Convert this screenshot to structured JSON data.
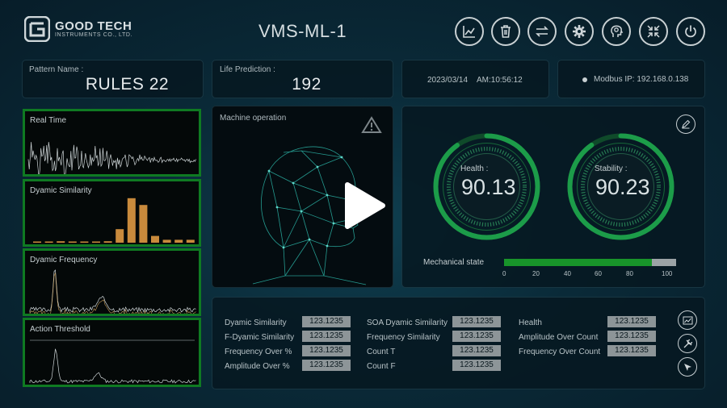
{
  "header": {
    "company_name": "GOOD TECH",
    "company_sub": "INSTRUMENTS CO., LTD.",
    "app_title": "VMS-ML-1"
  },
  "toolbar": {
    "buttons": [
      {
        "name": "trend-icon"
      },
      {
        "name": "trash-icon"
      },
      {
        "name": "swap-icon"
      },
      {
        "name": "gear-icon"
      },
      {
        "name": "brain-head-icon"
      },
      {
        "name": "collapse-icon"
      },
      {
        "name": "power-icon"
      }
    ]
  },
  "info": {
    "pattern_label": "Pattern Name :",
    "pattern_value": "RULES 22",
    "life_label": "Life Prediction :",
    "life_value": "192",
    "date": "2023/03/14",
    "time": "AM:10:56:12",
    "modbus": "Modbus IP: 192.168.0.138"
  },
  "charts": {
    "real_time": "Real Time",
    "dyn_similarity": "Dyamic Similarity",
    "dyn_frequency": "Dyamic Frequency",
    "action_threshold": "Action Threshold",
    "dyn_similarity_bars": [
      0.02,
      0.02,
      0.03,
      0.02,
      0.02,
      0.02,
      0.03,
      0.28,
      0.92,
      0.78,
      0.14,
      0.06,
      0.06,
      0.06
    ]
  },
  "machine": {
    "title": "Machine operation"
  },
  "status": {
    "health_label": "Health :",
    "health_value": "90.13",
    "stability_label": "Stability :",
    "stability_value": "90.23",
    "mech_label": "Mechanical state",
    "mech_level": 0.86,
    "scale": [
      "0",
      "20",
      "40",
      "60",
      "80",
      "100"
    ],
    "colors": {
      "gauge": "#1c9c49",
      "bar": "#18942a",
      "bar_track": "#9ba3a6"
    }
  },
  "readings": {
    "col1": [
      {
        "label": "Dyamic Similarity",
        "value": "123.1235"
      },
      {
        "label": "F-Dyamic Similarity",
        "value": "123.1235"
      },
      {
        "label": "Frequency Over %",
        "value": "123.1235"
      },
      {
        "label": "Amplitude Over %",
        "value": "123.1235"
      }
    ],
    "col2": [
      {
        "label": "SOA Dyamic Similarity",
        "value": "123.1235"
      },
      {
        "label": "Frequency Similarity",
        "value": "123.1235"
      },
      {
        "label": "Count T",
        "value": "123.1235"
      },
      {
        "label": "Count F",
        "value": "123.1235"
      }
    ],
    "col3": [
      {
        "label": "Health",
        "value": "123.1235"
      },
      {
        "label": "Amplitude Over Count",
        "value": "123.1235"
      },
      {
        "label": "Frequency Over Count",
        "value": "123.1235"
      }
    ]
  }
}
